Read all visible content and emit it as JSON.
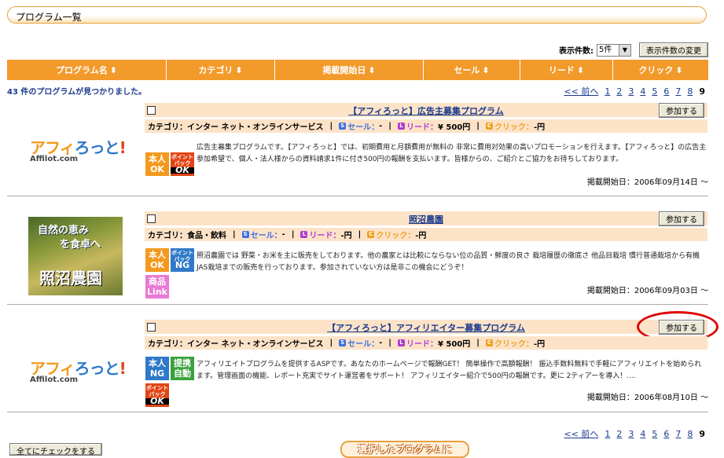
{
  "page": {
    "title": "プログラム一覧"
  },
  "count_control": {
    "label": "表示件数:",
    "selected": "5件",
    "change_button": "表示件数の変更"
  },
  "table_header": [
    "プログラム名",
    "カテゴリ",
    "掲載開始日",
    "セール",
    "リード",
    "クリック"
  ],
  "found_text": "43 件のプログラムが見つかりました。",
  "pager": {
    "prev": "<< 前へ",
    "pages": [
      "1",
      "2",
      "3",
      "4",
      "5",
      "6",
      "7",
      "8"
    ],
    "current": "9"
  },
  "sort_icon": "sort-arrows-icon",
  "programs": [
    {
      "title": "【アフィろっと】広告主募集プログラム",
      "join": "参加する",
      "category_label": "カテゴリ：",
      "category": "インター ネット・オンラインサービス",
      "sale_label": "セール：",
      "sale": "-",
      "lead_label": "リード：",
      "lead": "¥ 500円",
      "click_label": "クリック：",
      "click": "-円",
      "desc": "広告主募集プログラムです。【アフィろっと】では、初期費用と月額費用が無料の 非常に費用対効果の高いプロモーションを行えます。【アフィろっと】の広告主参加希望で、個人・法人様からの資料請求1件に付き500円の報酬を支払います。皆様からの、ご紹介とご協力をお待ちしております。",
      "date": "掲載開始日：2006年09月14日 〜",
      "logo_text": "アフィろっと!",
      "logo_sub": "Affilot.com",
      "badges": [
        [
          "本人",
          "OK"
        ],
        [
          "ポイント",
          "バック",
          "OK"
        ]
      ]
    },
    {
      "title": "照沼農園",
      "join": "参加する",
      "category_label": "カテゴリ：",
      "category": "食品・飲料",
      "sale_label": "セール：",
      "sale": "-",
      "lead_label": "リード：",
      "lead": "-円",
      "click_label": "クリック：",
      "click": "-円",
      "desc": "照沼農園では 野菜・お米を主に販売をしております。他の農家とは比較にならない位の品質・鮮度の良さ 栽培履歴の徹底さ 他品目栽培 慣行普通栽培から有機JAS栽培までの販売を行っております。参加されていない方は是非この機会にどうぞ！",
      "date": "掲載開始日：2006年09月03日 〜",
      "banner_lines": [
        "自然の恵み",
        "を食卓へ",
        "照沼農園"
      ],
      "badges": [
        [
          "本人",
          "OK"
        ],
        [
          "ポイント",
          "バック",
          "NG"
        ],
        [
          "商品",
          "Link"
        ]
      ]
    },
    {
      "title": "【アフィろっと】アフィリエイター募集プログラム",
      "join": "参加する",
      "category_label": "カテゴリ：",
      "category": "インター ネット・オンラインサービス",
      "sale_label": "セール：",
      "sale": "-",
      "lead_label": "リード：",
      "lead": "¥ 500円",
      "click_label": "クリック：",
      "click": "-円",
      "desc": "アフィリエイトプログラムを提供するASPです。あなたのホームページで報酬GET！ 簡単操作で高額報酬！ 振込手数料無料で手軽にアフィリエイトを始められます。管理画面の機能、レポート充実でサイト運営者をサポート！ アフィリエイター紹介で500円の報酬です。更に 2ティアーを導入！....",
      "date": "掲載開始日：2006年08月10日 〜",
      "logo_text": "アフィろっと!",
      "logo_sub": "Affilot.com",
      "badges": [
        [
          "本人",
          "NG"
        ],
        [
          "提携",
          "自動"
        ],
        [
          "ポイント",
          "バック",
          "OK"
        ]
      ]
    }
  ],
  "check_all": "全てにチェックをする",
  "bottom_button": "選択したプログラムに",
  "colors": {
    "accent": "#f29a2a",
    "link": "#1a3a8c",
    "card_bg": "#fce3c8",
    "highlight": "#e00000"
  }
}
